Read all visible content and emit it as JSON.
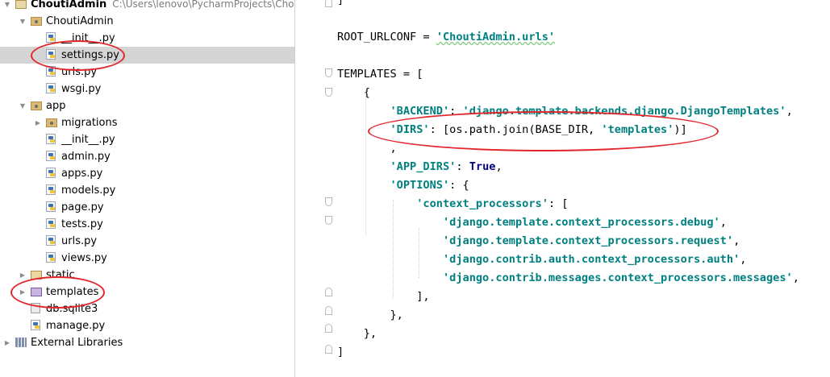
{
  "project": {
    "root_name": "ChoutiAdmin",
    "root_path": "C:\\Users\\lenovo\\PycharmProjects\\ChoutiAdmin",
    "nodes": [
      {
        "label": "ChoutiAdmin",
        "type": "package",
        "state": "expanded"
      },
      {
        "label": "__init__.py",
        "type": "python-file"
      },
      {
        "label": "settings.py",
        "type": "python-file",
        "selected": true
      },
      {
        "label": "urls.py",
        "type": "python-file"
      },
      {
        "label": "wsgi.py",
        "type": "python-file"
      },
      {
        "label": "app",
        "type": "package",
        "state": "expanded"
      },
      {
        "label": "migrations",
        "type": "package",
        "state": "collapsed"
      },
      {
        "label": "__init__.py",
        "type": "python-file"
      },
      {
        "label": "admin.py",
        "type": "python-file"
      },
      {
        "label": "apps.py",
        "type": "python-file"
      },
      {
        "label": "models.py",
        "type": "python-file"
      },
      {
        "label": "page.py",
        "type": "python-file"
      },
      {
        "label": "tests.py",
        "type": "python-file"
      },
      {
        "label": "urls.py",
        "type": "python-file"
      },
      {
        "label": "views.py",
        "type": "python-file"
      },
      {
        "label": "static",
        "type": "folder",
        "state": "collapsed"
      },
      {
        "label": "templates",
        "type": "template-folder",
        "state": "collapsed"
      },
      {
        "label": "db.sqlite3",
        "type": "database-file"
      },
      {
        "label": "manage.py",
        "type": "python-file"
      },
      {
        "label": "External Libraries",
        "type": "libraries",
        "state": "collapsed"
      }
    ]
  },
  "editor": {
    "lines": [
      [
        {
          "t": "]"
        }
      ],
      [],
      [
        {
          "t": "ROOT_URLCONF = "
        },
        {
          "t": "'ChoutiAdmin.urls'",
          "c": "str"
        }
      ],
      [],
      [
        {
          "t": "TEMPLATES = ["
        }
      ],
      [
        {
          "t": "    {"
        }
      ],
      [
        {
          "t": "        "
        },
        {
          "t": "'BACKEND'",
          "c": "str"
        },
        {
          "t": ": "
        },
        {
          "t": "'django.template.backends.django.DjangoTemplates'",
          "c": "str"
        },
        {
          "t": ","
        }
      ],
      [
        {
          "t": "        "
        },
        {
          "t": "'DIRS'",
          "c": "str"
        },
        {
          "t": ": [os.path.join(BASE_DIR, "
        },
        {
          "t": "'templates'",
          "c": "str"
        },
        {
          "t": ")]"
        }
      ],
      [
        {
          "t": "        ,"
        }
      ],
      [
        {
          "t": "        "
        },
        {
          "t": "'APP_DIRS'",
          "c": "str"
        },
        {
          "t": ": "
        },
        {
          "t": "True",
          "c": "kw"
        },
        {
          "t": ","
        }
      ],
      [
        {
          "t": "        "
        },
        {
          "t": "'OPTIONS'",
          "c": "str"
        },
        {
          "t": ": {"
        }
      ],
      [
        {
          "t": "            "
        },
        {
          "t": "'context_processors'",
          "c": "str"
        },
        {
          "t": ": ["
        }
      ],
      [
        {
          "t": "                "
        },
        {
          "t": "'django.template.context_processors.debug'",
          "c": "str"
        },
        {
          "t": ","
        }
      ],
      [
        {
          "t": "                "
        },
        {
          "t": "'django.template.context_processors.request'",
          "c": "str"
        },
        {
          "t": ","
        }
      ],
      [
        {
          "t": "                "
        },
        {
          "t": "'django.contrib.auth.context_processors.auth'",
          "c": "str"
        },
        {
          "t": ","
        }
      ],
      [
        {
          "t": "                "
        },
        {
          "t": "'django.contrib.messages.context_processors.messages'",
          "c": "str"
        },
        {
          "t": ","
        }
      ],
      [
        {
          "t": "            ],"
        }
      ],
      [
        {
          "t": "        },"
        }
      ],
      [
        {
          "t": "    },"
        }
      ],
      [
        {
          "t": "]"
        }
      ]
    ]
  },
  "annotations": {
    "color": "#e3252c"
  },
  "colors": {
    "string": "#008080",
    "keyword": "#000080",
    "selection": "#d5d5d5"
  }
}
